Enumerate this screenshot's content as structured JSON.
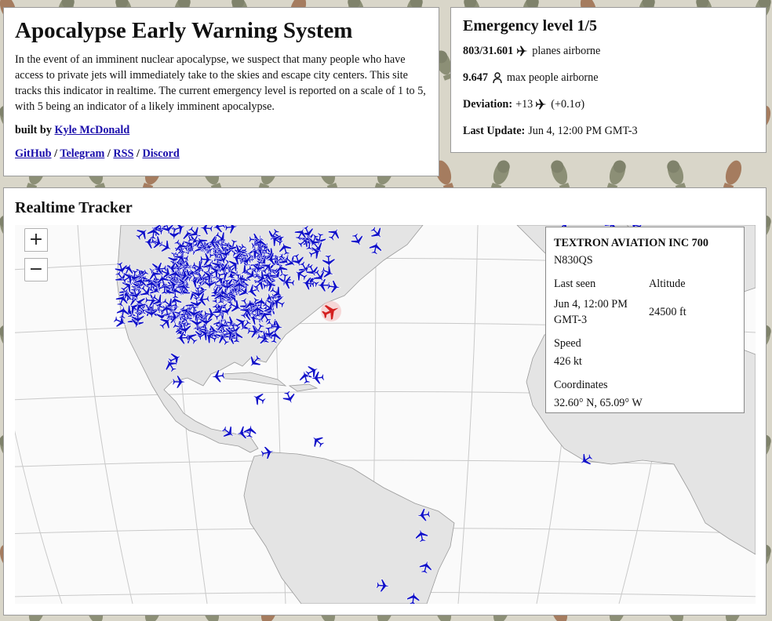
{
  "intro": {
    "title": "Apocalypse Early Warning System",
    "description": "In the event of an imminent nuclear apocalypse, we suspect that many people who have access to private jets will immediately take to the skies and escape city centers. This site tracks this indicator in realtime. The current emergency level is reported on a scale of 1 to 5, with 5 being an indicator of a likely imminent apocalypse.",
    "built_prefix": "built by",
    "author": "Kyle McDonald",
    "links": [
      "GitHub",
      "Telegram",
      "RSS",
      "Discord"
    ],
    "link_sep": "/"
  },
  "status": {
    "title": "Emergency level 1/5",
    "planes_value": "803/31.601",
    "planes_label": "planes airborne",
    "people_value": "9.647",
    "people_label": "max people airborne",
    "deviation_label": "Deviation:",
    "deviation_value": "+13",
    "deviation_sigma": "(+0.1σ)",
    "update_label": "Last Update:",
    "update_value": "Jun 4, 12:00 PM GMT-3"
  },
  "tracker": {
    "title": "Realtime Tracker",
    "zoom_in": "+",
    "zoom_out": "−",
    "popup": {
      "aircraft": "TEXTRON AVIATION INC 700",
      "registration": "N830QS",
      "last_seen_label": "Last seen",
      "last_seen_value": "Jun 4, 12:00 PM GMT-3",
      "altitude_label": "Altitude",
      "altitude_value": "24500 ft",
      "speed_label": "Speed",
      "speed_value": "426 kt",
      "coords_label": "Coordinates",
      "coords_value": "32.60° N, 65.09° W"
    }
  },
  "colors": {
    "plane": "#1010c8",
    "selected_plane": "#d42020",
    "land": "#e4e4e4",
    "water": "#fafafa"
  },
  "icons": [
    "plane-icon",
    "person-icon",
    "bomb-icon"
  ]
}
